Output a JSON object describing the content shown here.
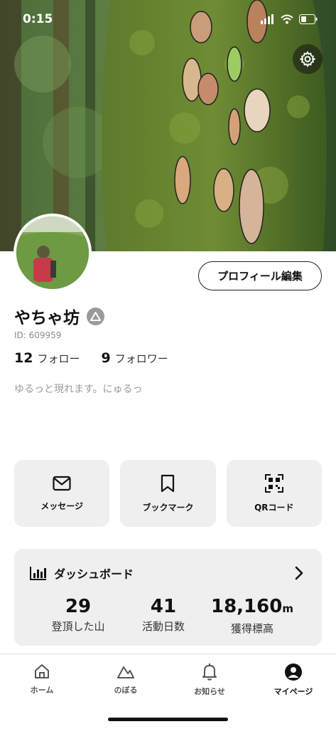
{
  "status_bar": {
    "time": "0:15"
  },
  "cover": {
    "description_icon": "mossy-tree-with-leaf-faces"
  },
  "profile": {
    "edit_button": "プロフィール編集",
    "username": "やちゃ坊",
    "id_text": "ID: 609959",
    "follow_count": "12",
    "follow_label": "フォロー",
    "follower_count": "9",
    "follower_label": "フォロワー",
    "bio": "ゆるっと現れます。にゅるっ"
  },
  "actions": [
    {
      "label": "メッセージ",
      "icon": "envelope-icon"
    },
    {
      "label": "ブックマーク",
      "icon": "bookmark-icon"
    },
    {
      "label": "QRコード",
      "icon": "qr-code-icon"
    }
  ],
  "dashboard": {
    "title": "ダッシュボード",
    "stats": [
      {
        "value": "29",
        "unit": "",
        "label": "登頂した山"
      },
      {
        "value": "41",
        "unit": "",
        "label": "活動日数"
      },
      {
        "value": "18,160",
        "unit": "m",
        "label": "獲得標高"
      }
    ]
  },
  "tabs": [
    {
      "label": "ホーム",
      "icon": "home-icon",
      "active": false
    },
    {
      "label": "のぼる",
      "icon": "mountain-icon",
      "active": false
    },
    {
      "label": "お知らせ",
      "icon": "bell-icon",
      "active": false
    },
    {
      "label": "マイページ",
      "icon": "user-icon",
      "active": true
    }
  ],
  "colors": {
    "card_bg": "#efefef",
    "text": "#111111",
    "muted": "#8a8a8a"
  }
}
